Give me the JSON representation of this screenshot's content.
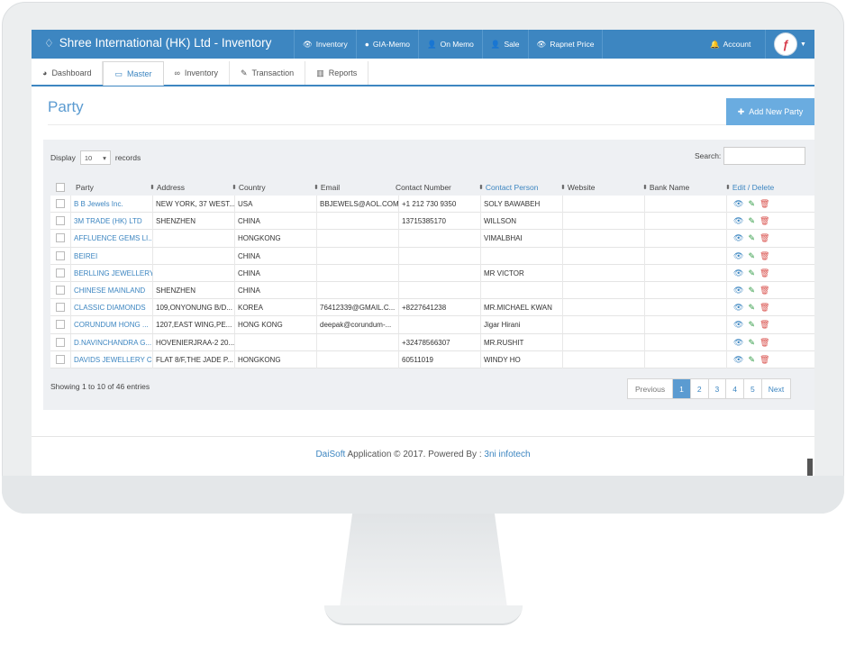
{
  "app": {
    "title": "Shree International (HK) Ltd - Inventory",
    "logo_icon": "diamond-icon"
  },
  "topmenu": [
    {
      "label": "Inventory",
      "icon": "eye-icon",
      "glyph": "👁"
    },
    {
      "label": "GIA-Memo",
      "icon": "circle-icon",
      "glyph": "●"
    },
    {
      "label": "On Memo",
      "icon": "user-icon",
      "glyph": "👤"
    },
    {
      "label": "Sale",
      "icon": "user-icon",
      "glyph": "👤"
    },
    {
      "label": "Rapnet Price",
      "icon": "eye-icon",
      "glyph": "👁"
    }
  ],
  "account": {
    "label": "Account",
    "icon": "bell-icon"
  },
  "tabs": [
    {
      "label": "Dashboard",
      "icon": "dashboard-icon",
      "glyph": "◕"
    },
    {
      "label": "Master",
      "icon": "monitor-icon",
      "glyph": "▭"
    },
    {
      "label": "Inventory",
      "icon": "glasses-icon",
      "glyph": "∞"
    },
    {
      "label": "Transaction",
      "icon": "edit-icon",
      "glyph": "✎"
    },
    {
      "label": "Reports",
      "icon": "bar-chart-icon",
      "glyph": "▥"
    }
  ],
  "page": {
    "title": "Party",
    "add_button": "Add New Party"
  },
  "table_controls": {
    "display_label": "Display",
    "page_size": "10",
    "records_label": "records",
    "search_label": "Search:"
  },
  "columns": [
    "Party",
    "Address",
    "Country",
    "Email",
    "Contact Number",
    "Contact Person",
    "Website",
    "Bank Name",
    "Edit / Delete"
  ],
  "rows": [
    {
      "party": "B B Jewels Inc.",
      "address": "NEW YORK, 37 WEST...",
      "country": "USA",
      "email": "BBJEWELS@AOL.COM",
      "contact_number": "+1 212 730 9350",
      "contact_person": "SOLY BAWABEH",
      "website": "",
      "bank": ""
    },
    {
      "party": "3M TRADE (HK) LTD",
      "address": "SHENZHEN",
      "country": "CHINA",
      "email": "",
      "contact_number": "13715385170",
      "contact_person": "WILLSON",
      "website": "",
      "bank": ""
    },
    {
      "party": "AFFLUENCE GEMS LI...",
      "address": "",
      "country": "HONGKONG",
      "email": "",
      "contact_number": "",
      "contact_person": "VIMALBHAI",
      "website": "",
      "bank": ""
    },
    {
      "party": "BEIREI",
      "address": "",
      "country": "CHINA",
      "email": "",
      "contact_number": "",
      "contact_person": "",
      "website": "",
      "bank": ""
    },
    {
      "party": "BERLLING JEWELLERY",
      "address": "",
      "country": "CHINA",
      "email": "",
      "contact_number": "",
      "contact_person": "MR VICTOR",
      "website": "",
      "bank": ""
    },
    {
      "party": "CHINESE MAINLAND",
      "address": "SHENZHEN",
      "country": "CHINA",
      "email": "",
      "contact_number": "",
      "contact_person": "",
      "website": "",
      "bank": ""
    },
    {
      "party": "CLASSIC DIAMONDS",
      "address": "109,ONYONUNG B/D...",
      "country": "KOREA",
      "email": "76412339@GMAIL.C...",
      "contact_number": "+8227641238",
      "contact_person": "MR.MICHAEL KWAN",
      "website": "",
      "bank": ""
    },
    {
      "party": "CORUNDUM HONG ...",
      "address": "1207,EAST WING,PE...",
      "country": "HONG KONG",
      "email": "deepak@corundum-...",
      "contact_number": "",
      "contact_person": "Jigar Hirani",
      "website": "",
      "bank": ""
    },
    {
      "party": "D.NAVINCHANDRA G...",
      "address": "HOVENIERJRAA-2 20...",
      "country": "",
      "email": "",
      "contact_number": "+32478566307",
      "contact_person": "MR.RUSHIT",
      "website": "",
      "bank": ""
    },
    {
      "party": "DAVIDS JEWELLERY C...",
      "address": "FLAT 8/F,THE JADE P...",
      "country": "HONGKONG",
      "email": "",
      "contact_number": "60511019",
      "contact_person": "WINDY HO",
      "website": "",
      "bank": ""
    }
  ],
  "row_actions": {
    "view": "eye-icon",
    "edit": "pencil-icon",
    "delete": "trash-icon"
  },
  "pagination": {
    "summary": "Showing 1 to 10 of 46 entries",
    "previous": "Previous",
    "pages": [
      "1",
      "2",
      "3",
      "4",
      "5"
    ],
    "current": "1",
    "next": "Next"
  },
  "footer": {
    "brand": "DaiSoft",
    "text": " Application © 2017. Powered By : ",
    "company": "3ni infotech"
  },
  "colors": {
    "accent": "#3d86c1",
    "edit": "#2f9a43",
    "delete": "#d9534f"
  }
}
